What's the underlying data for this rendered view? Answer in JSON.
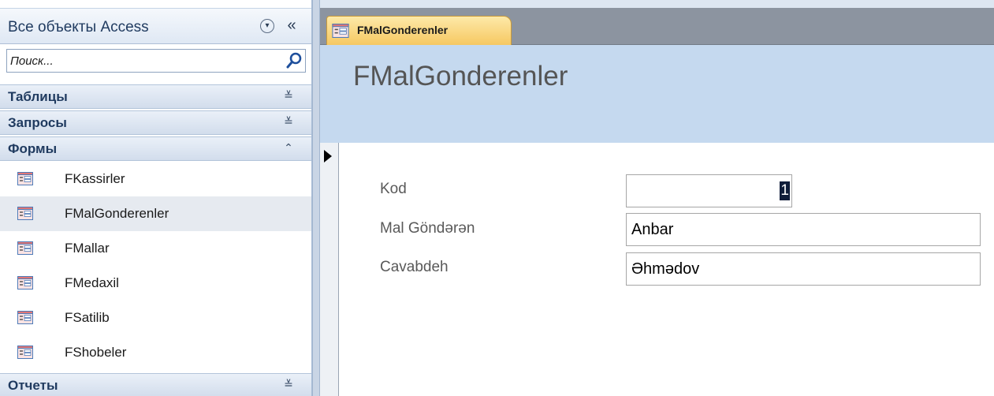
{
  "nav": {
    "title": "Все объекты Access",
    "dropdown_icon": "chevron-down-circle-icon",
    "collapse_icon": "double-chevron-left-icon",
    "collapse_glyph": "«",
    "search": {
      "placeholder": "Поиск...",
      "icon": "search-icon"
    },
    "groups": {
      "tables": {
        "label": "Таблицы",
        "state": "collapsed",
        "glyph": "≚"
      },
      "queries": {
        "label": "Запросы",
        "state": "collapsed",
        "glyph": "≚"
      },
      "forms": {
        "label": "Формы",
        "state": "expanded",
        "glyph": "⌃"
      },
      "reports": {
        "label": "Отчеты",
        "state": "collapsed",
        "glyph": "≚"
      }
    },
    "form_items": [
      {
        "label": "FKassirler",
        "icon": "form-icon",
        "selected": false
      },
      {
        "label": "FMalGonderenler",
        "icon": "form-icon",
        "selected": true
      },
      {
        "label": "FMallar",
        "icon": "form-icon",
        "selected": false
      },
      {
        "label": "FMedaxil",
        "icon": "form-icon",
        "selected": false
      },
      {
        "label": "FSatilib",
        "icon": "form-icon",
        "selected": false
      },
      {
        "label": "FShobeler",
        "icon": "form-icon",
        "selected": false
      }
    ]
  },
  "document": {
    "tab": {
      "label": "FMalGonderenler",
      "icon": "form-icon"
    },
    "form": {
      "title": "FMalGonderenler",
      "fields": [
        {
          "label": "Kod",
          "value": "1"
        },
        {
          "label": "Mal Göndərən",
          "value": "Anbar"
        },
        {
          "label": "Cavabdeh",
          "value": "Əhmədov"
        }
      ]
    }
  },
  "colors": {
    "tab_active": "#f6c862",
    "form_header": "#c5d9ef",
    "tabbar": "#8c94a0",
    "nav_group": "#d2ddec"
  }
}
